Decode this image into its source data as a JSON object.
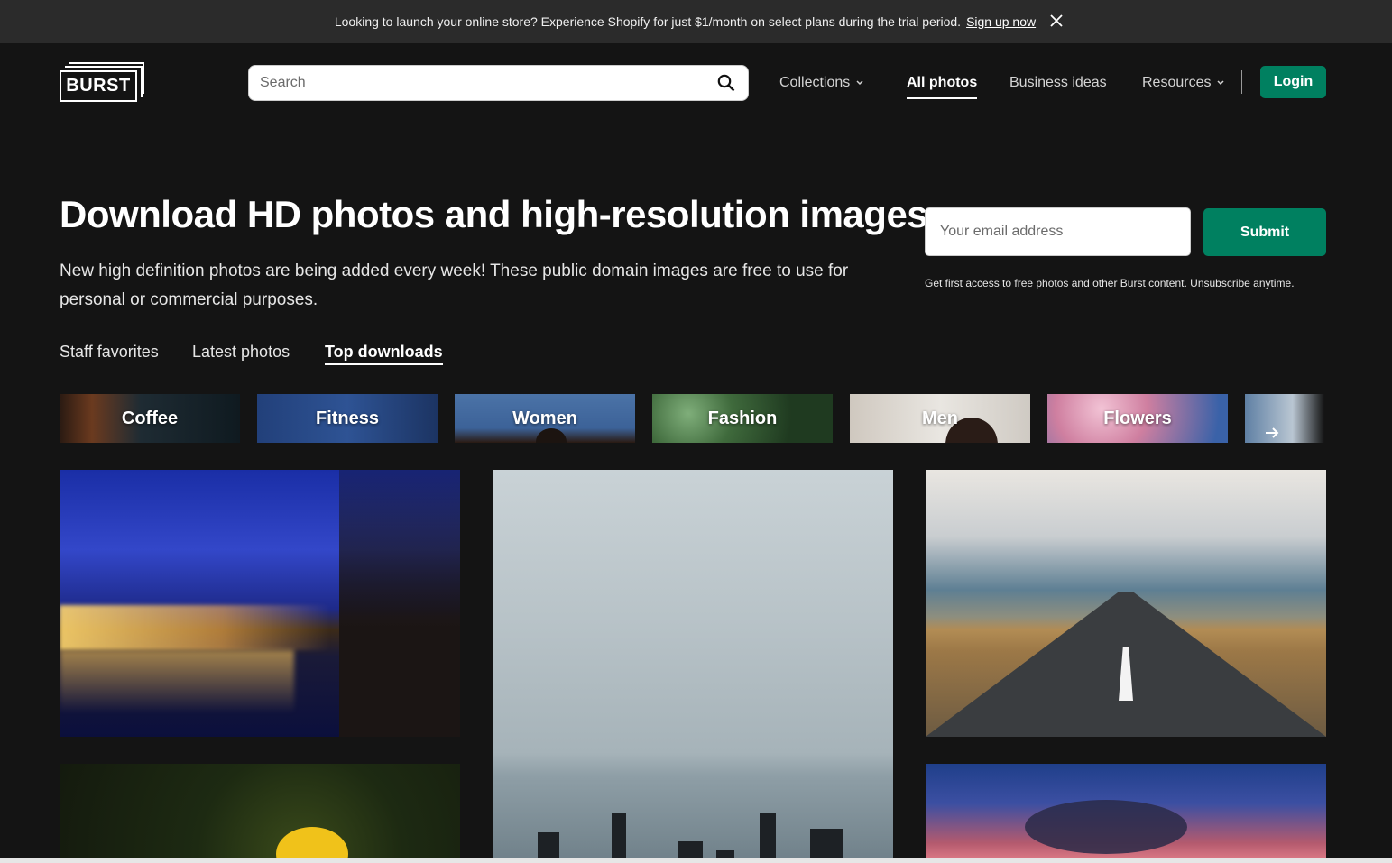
{
  "announcement": {
    "message": "Looking to launch your online store? Experience Shopify for just $1/month on select plans during the trial period.",
    "link_label": "Sign up now"
  },
  "header": {
    "logo_text": "BURST",
    "search_placeholder": "Search",
    "nav": [
      {
        "label": "Collections",
        "has_dropdown": true,
        "active": false
      },
      {
        "label": "All photos",
        "has_dropdown": false,
        "active": true
      },
      {
        "label": "Business ideas",
        "has_dropdown": false,
        "active": false
      },
      {
        "label": "Resources",
        "has_dropdown": true,
        "active": false
      }
    ],
    "login_label": "Login"
  },
  "hero": {
    "title": "Download HD photos and high-resolution images",
    "subtitle": "New high definition photos are being added every week! These public domain images are free to use for personal or commercial purposes.",
    "email_placeholder": "Your email address",
    "submit_label": "Submit",
    "disclaimer": "Get first access to free photos and other Burst content. Unsubscribe anytime."
  },
  "tabs": [
    {
      "label": "Staff favorites",
      "active": false
    },
    {
      "label": "Latest photos",
      "active": false
    },
    {
      "label": "Top downloads",
      "active": true
    }
  ],
  "categories": [
    {
      "label": "Coffee"
    },
    {
      "label": "Fitness"
    },
    {
      "label": "Women"
    },
    {
      "label": "Fashion"
    },
    {
      "label": "Men"
    },
    {
      "label": "Flowers"
    }
  ],
  "colors": {
    "background": "#141414",
    "announcement_bg": "#2b2b2b",
    "accent_green": "#008060",
    "text": "#ffffff"
  },
  "icons": {
    "search": "search-icon",
    "close": "close-icon",
    "chevron": "chevron-down-icon",
    "next": "arrow-right-icon"
  }
}
